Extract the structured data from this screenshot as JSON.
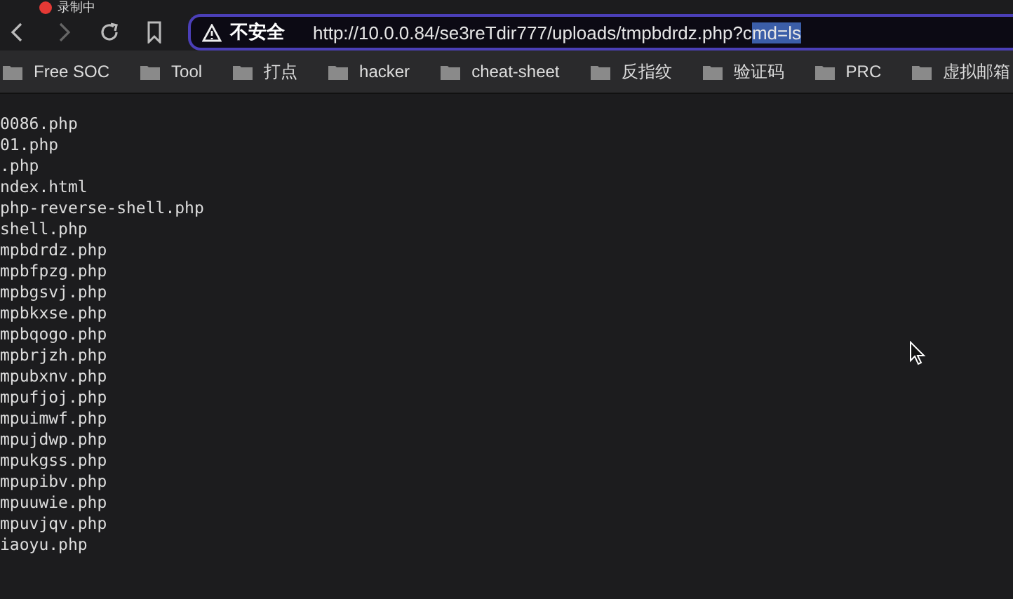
{
  "recording": {
    "label": "录制中"
  },
  "address_bar": {
    "security": "不安全",
    "url": "http://10.0.0.84/se3reTdir777/uploads/tmpbdrdz.php?c",
    "url_selected": "md=ls"
  },
  "bookmarks": [
    "Free SOC",
    "Tool",
    "打点",
    "hacker",
    "cheat-sheet",
    "反指纹",
    "验证码",
    "PRC",
    "虚拟邮箱"
  ],
  "listing": [
    "0086.php",
    "01.php",
    ".php",
    "ndex.html",
    "php-reverse-shell.php",
    "shell.php",
    "mpbdrdz.php",
    "mpbfpzg.php",
    "mpbgsvj.php",
    "mpbkxse.php",
    "mpbqogo.php",
    "mpbrjzh.php",
    "mpubxnv.php",
    "mpufjoj.php",
    "mpuimwf.php",
    "mpujdwp.php",
    "mpukgss.php",
    "mpupibv.php",
    "mpuuwie.php",
    "mpuvjqv.php",
    "iaoyu.php"
  ]
}
